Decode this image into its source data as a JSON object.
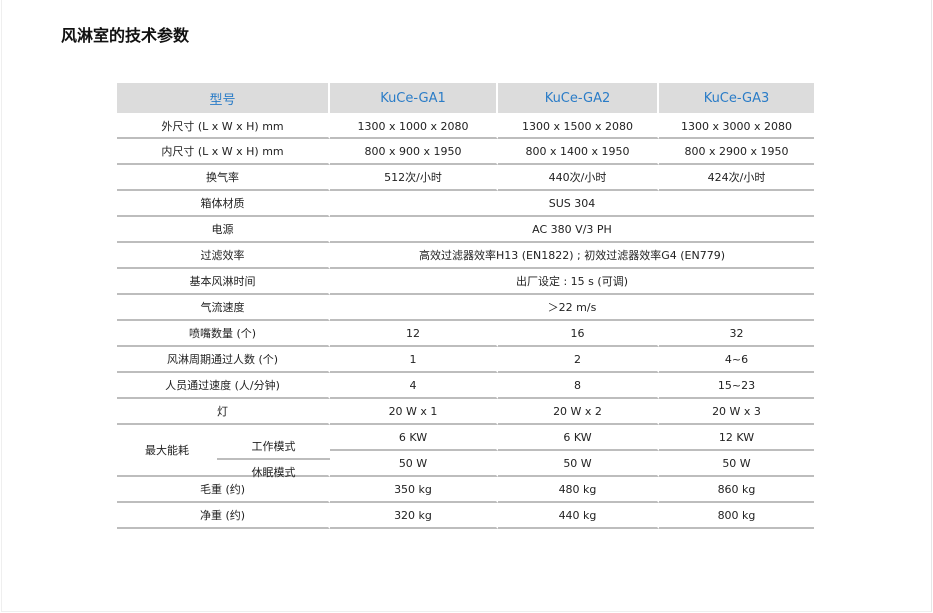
{
  "page": {
    "title": "风淋室的技术参数"
  },
  "table": {
    "headers": [
      "型号",
      "KuCe-GA1",
      "KuCe-GA2",
      "KuCe-GA3"
    ],
    "rows": [
      {
        "label": "外尺寸 (L x W x H) mm",
        "values": [
          "1300 x 1000 x 2080",
          "1300 x 1500 x 2080",
          "1300 x 3000 x 2080"
        ]
      },
      {
        "label": "内尺寸 (L x W x H) mm",
        "values": [
          "800 x 900 x 1950",
          "800 x 1400 x 1950",
          "800 x 2900 x 1950"
        ]
      },
      {
        "label": "换气率",
        "values": [
          "512次/小时",
          "440次/小时",
          "424次/小时"
        ]
      },
      {
        "label": "箱体材质",
        "merged": "SUS 304"
      },
      {
        "label": "电源",
        "merged": "AC 380 V/3 PH"
      },
      {
        "label": "过滤效率",
        "merged": "高效过滤器效率H13 (EN1822) ; 初效过滤器效率G4 (EN779)"
      },
      {
        "label": "基本风淋时间",
        "merged": "出厂设定 : 15 s (可调)"
      },
      {
        "label": "气流速度",
        "merged": "＞22 m/s"
      },
      {
        "label": "喷嘴数量 (个)",
        "values": [
          "12",
          "16",
          "32"
        ]
      },
      {
        "label": "风淋周期通过人数 (个)",
        "values": [
          "1",
          "2",
          "4~6"
        ]
      },
      {
        "label": "人员通过速度 (人/分钟)",
        "values": [
          "4",
          "8",
          "15~23"
        ]
      },
      {
        "label": "灯",
        "values": [
          "20 W x 1",
          "20 W x 2",
          "20 W x 3"
        ]
      }
    ],
    "power": {
      "label": "最大能耗",
      "modes": [
        {
          "label": "工作模式",
          "values": [
            "6 KW",
            "6 KW",
            "12 KW"
          ]
        },
        {
          "label": "休眠模式",
          "values": [
            "50 W",
            "50 W",
            "50 W"
          ]
        }
      ]
    },
    "tail_rows": [
      {
        "label": "毛重 (约)",
        "values": [
          "350 kg",
          "480 kg",
          "860 kg"
        ]
      },
      {
        "label": "净重 (约)",
        "values": [
          "320 kg",
          "440 kg",
          "800 kg"
        ]
      }
    ]
  }
}
